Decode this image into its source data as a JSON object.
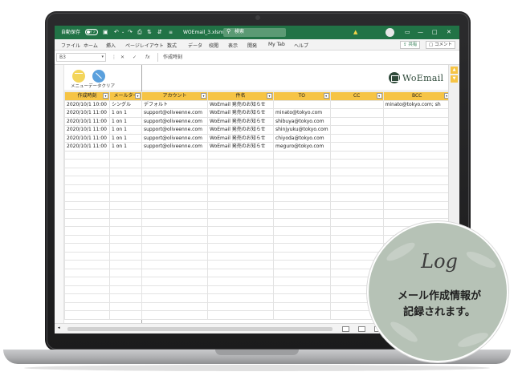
{
  "titlebar": {
    "autosave_label": "自動保存",
    "autosave_state": "オフ",
    "filename": "WOEmail_3.xlsm ⌄",
    "search_placeholder": "検索",
    "share_label": "共有",
    "comment_label": "コメント",
    "accent_color": "#217346"
  },
  "ribbon": {
    "tabs": [
      "ファイル",
      "ホーム",
      "挿入",
      "ページレイアウト",
      "数式",
      "データ",
      "校閲",
      "表示",
      "開発",
      "My Tab",
      "ヘルプ"
    ]
  },
  "formula_bar": {
    "name_box": "B3",
    "fx_label": "fx",
    "value": "作成時刻"
  },
  "banner": {
    "menu_label": "メニュー",
    "clear_label": "データクリア",
    "logo_text": "WoEmail"
  },
  "table": {
    "headers": [
      "作成時刻",
      "メールタイ",
      "アカウント",
      "件名",
      "TO",
      "CC",
      "BCC"
    ],
    "rows": [
      [
        "2020/10/1 10:00",
        "シングル",
        "デフォルト",
        "WoEmail 発売のお知らせ",
        "",
        "",
        "minato@tokyo.com; sh"
      ],
      [
        "2020/10/1 11:00",
        "1 on 1",
        "support@oliveenne.com",
        "WoEmail 発売のお知らせ",
        "minato@tokyo.com",
        "",
        ""
      ],
      [
        "2020/10/1 11:00",
        "1 on 1",
        "support@oliveenne.com",
        "WoEmail 発売のお知らせ",
        "shibuya@tokyo.com",
        "",
        ""
      ],
      [
        "2020/10/1 11:00",
        "1 on 1",
        "support@oliveenne.com",
        "WoEmail 発売のお知らせ",
        "shinjyuku@tokyo.com",
        "",
        ""
      ],
      [
        "2020/10/1 11:00",
        "1 on 1",
        "support@oliveenne.com",
        "WoEmail 発売のお知らせ",
        "chiyoda@tokyo.com",
        "",
        ""
      ],
      [
        "2020/10/1 11:00",
        "1 on 1",
        "support@oliveenne.com",
        "WoEmail 発売のお知らせ",
        "meguro@tokyo.com",
        "",
        ""
      ]
    ],
    "header_color": "#f6c445"
  },
  "callout": {
    "title": "Log",
    "line1": "メール作成情報が",
    "line2": "記録されます。",
    "bg_color": "#b6c2b6"
  }
}
